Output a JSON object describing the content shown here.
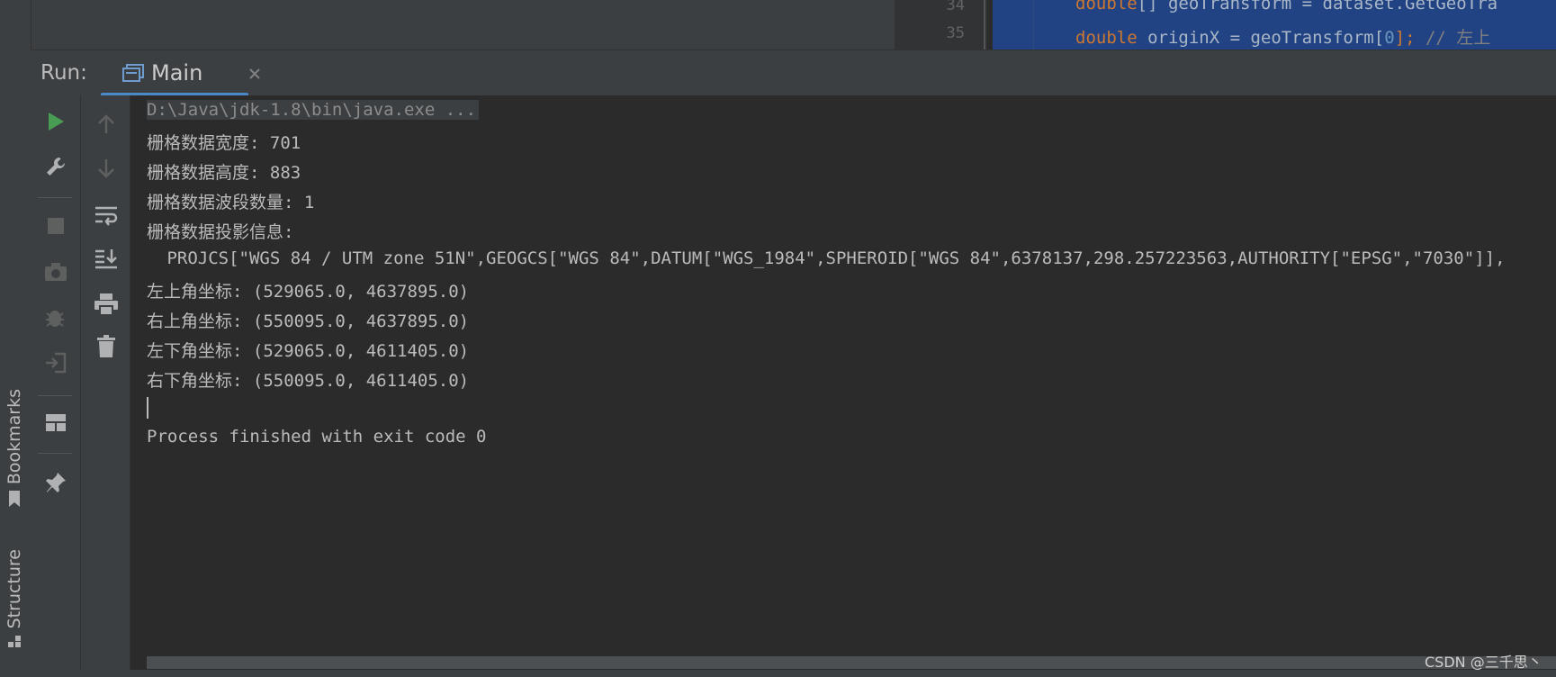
{
  "editor": {
    "lines": [
      {
        "number": "34",
        "code_kw": "double",
        "code_rest": "[] geoTransform = dataset.GetGeoTra"
      },
      {
        "number": "35",
        "code_kw": "double",
        "code_rest": " originX = geoTransform[",
        "code_num": "0",
        "code_tail": "]; ",
        "code_comment": "// 左上"
      }
    ]
  },
  "sidebar": {
    "tabs": [
      {
        "label": "Bookmarks"
      },
      {
        "label": "Structure"
      }
    ]
  },
  "run_panel": {
    "label": "Run:",
    "tab_name": "Main"
  },
  "toolbar": {
    "left_icons": [
      "run-icon",
      "wrench-icon",
      "stop-icon",
      "camera-icon",
      "debug-icon",
      "exit-icon",
      "layout-icon",
      "pin-icon"
    ],
    "right_icons": [
      "up-arrow-icon",
      "down-arrow-icon",
      "soft-wrap-icon",
      "scroll-to-end-icon",
      "print-icon",
      "trash-icon"
    ]
  },
  "console": {
    "command": "D:\\Java\\jdk-1.8\\bin\\java.exe ...",
    "output": [
      "栅格数据宽度: 701",
      "栅格数据高度: 883",
      "栅格数据波段数量: 1",
      "栅格数据投影信息:",
      " PROJCS[\"WGS 84 / UTM zone 51N\",GEOGCS[\"WGS 84\",DATUM[\"WGS_1984\",SPHEROID[\"WGS 84\",6378137,298.257223563,AUTHORITY[\"EPSG\",\"7030\"]],",
      "左上角坐标: (529065.0, 4637895.0)",
      "右上角坐标: (550095.0, 4637895.0)",
      "左下角坐标: (529065.0, 4611405.0)",
      "右下角坐标: (550095.0, 4611405.0)"
    ],
    "exit_message": "Process finished with exit code 0"
  },
  "watermark": "CSDN @三千思丶",
  "colors": {
    "run_green": "#499c54",
    "tab_underline": "#4a88c7",
    "selection": "#214283"
  }
}
